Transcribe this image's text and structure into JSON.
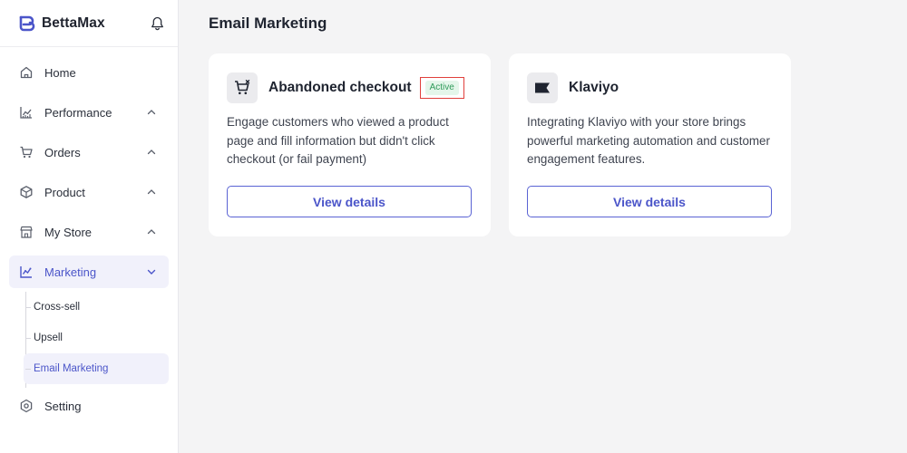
{
  "brand": {
    "name": "BettaMax",
    "accent": "#4b55c9"
  },
  "sidebar": {
    "items": [
      {
        "label": "Home",
        "icon": "home-icon",
        "expandable": false
      },
      {
        "label": "Performance",
        "icon": "chart-icon",
        "expandable": true,
        "chevron": "chevron-up-icon"
      },
      {
        "label": "Orders",
        "icon": "cart-icon",
        "expandable": true,
        "chevron": "chevron-up-icon"
      },
      {
        "label": "Product",
        "icon": "box-icon",
        "expandable": true,
        "chevron": "chevron-up-icon"
      },
      {
        "label": "My Store",
        "icon": "store-icon",
        "expandable": true,
        "chevron": "chevron-up-icon"
      },
      {
        "label": "Marketing",
        "icon": "marketing-icon",
        "expandable": true,
        "active": true,
        "chevron": "chevron-down-icon"
      },
      {
        "label": "Setting",
        "icon": "setting-icon",
        "expandable": false
      }
    ],
    "marketing_sub": [
      {
        "label": "Cross-sell"
      },
      {
        "label": "Upsell"
      },
      {
        "label": "Email Marketing",
        "active": true
      }
    ]
  },
  "main": {
    "title": "Email Marketing",
    "cards": [
      {
        "title": "Abandoned checkout",
        "icon": "cart-icon",
        "badge": "Active",
        "description": "Engage customers who viewed a product page and fill information but didn't click checkout (or fail payment)",
        "button": "View details"
      },
      {
        "title": "Klaviyo",
        "icon": "klaviyo-icon",
        "description": "Integrating Klaviyo with your store brings powerful marketing automation and customer engagement features.",
        "button": "View details"
      }
    ]
  },
  "colors": {
    "badge_bg": "#e4f6ea",
    "badge_text": "#2f9a5a",
    "highlight_border": "#e0403c"
  }
}
